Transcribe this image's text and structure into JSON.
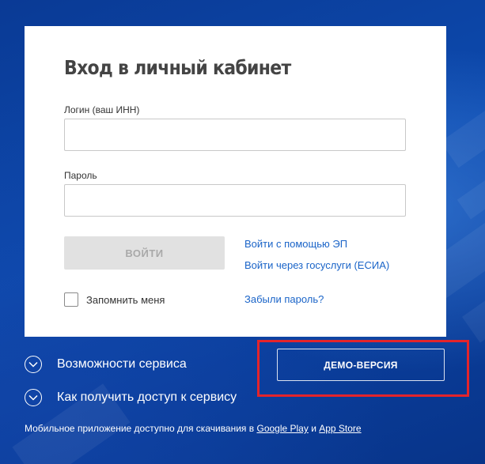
{
  "login_card": {
    "title": "Вход в личный кабинет",
    "login_label": "Логин (ваш ИНН)",
    "login_value": "",
    "password_label": "Пароль",
    "password_value": "",
    "login_button": "ВОЙТИ",
    "link_ep": "Войти с помощью ЭП",
    "link_esia": "Войти через госуслуги (ЕСИА)",
    "remember_label": "Запомнить меня",
    "forgot_link": "Забыли пароль?"
  },
  "service": {
    "features_label": "Возможности сервиса",
    "access_label": "Как получить доступ к сервису",
    "demo_button": "ДЕМО-ВЕРСИЯ"
  },
  "footer": {
    "text_prefix": "Мобильное приложение доступно для скачивания в ",
    "google_play": "Google Play",
    "and": " и ",
    "app_store": "App Store"
  },
  "icons": {
    "expand": "chevron-down-icon"
  },
  "colors": {
    "background": "#0b3f9e",
    "link": "#1a64c8",
    "highlight": "#e4242b",
    "button_disabled": "#e1e1e1"
  }
}
